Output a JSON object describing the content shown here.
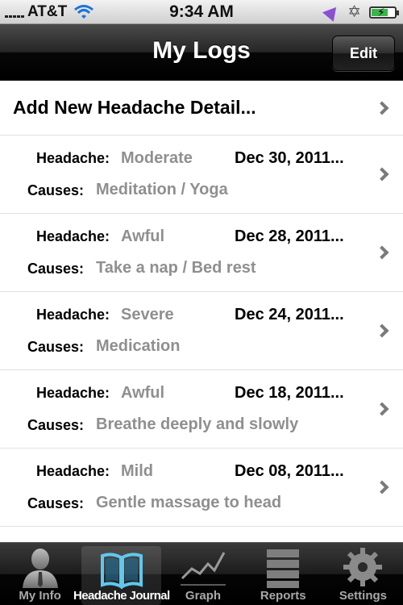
{
  "status_bar": {
    "carrier": "AT&T",
    "time": "9:34 AM",
    "icons": [
      "signal-icon",
      "wifi-icon",
      "location-icon",
      "bluetooth-icon",
      "battery-icon"
    ]
  },
  "nav": {
    "title": "My Logs",
    "edit_label": "Edit"
  },
  "table": {
    "add_label": "Add New Headache Detail...",
    "headache_label": "Headache:",
    "causes_label": "Causes:",
    "rows": [
      {
        "headache": "Moderate",
        "date": "Dec 30, 2011...",
        "causes": "Meditation / Yoga"
      },
      {
        "headache": "Awful",
        "date": "Dec 28, 2011...",
        "causes": "Take a nap / Bed rest"
      },
      {
        "headache": "Severe",
        "date": "Dec 24, 2011...",
        "causes": "Medication"
      },
      {
        "headache": "Awful",
        "date": "Dec 18, 2011...",
        "causes": "Breathe deeply and slowly"
      },
      {
        "headache": "Mild",
        "date": "Dec 08, 2011...",
        "causes": "Gentle massage to head"
      }
    ]
  },
  "tabs": [
    {
      "label": "My Info",
      "icon": "person-icon",
      "active": false
    },
    {
      "label": "Headache Journal",
      "icon": "book-icon",
      "active": true
    },
    {
      "label": "Graph",
      "icon": "graph-icon",
      "active": false
    },
    {
      "label": "Reports",
      "icon": "reports-icon",
      "active": false
    },
    {
      "label": "Settings",
      "icon": "gear-icon",
      "active": false
    }
  ],
  "colors": {
    "active_icon": "#5ec8ee",
    "value_gray": "#8f8f8f",
    "location_arrow": "#8a4fd2",
    "battery_green": "#39b54a"
  }
}
